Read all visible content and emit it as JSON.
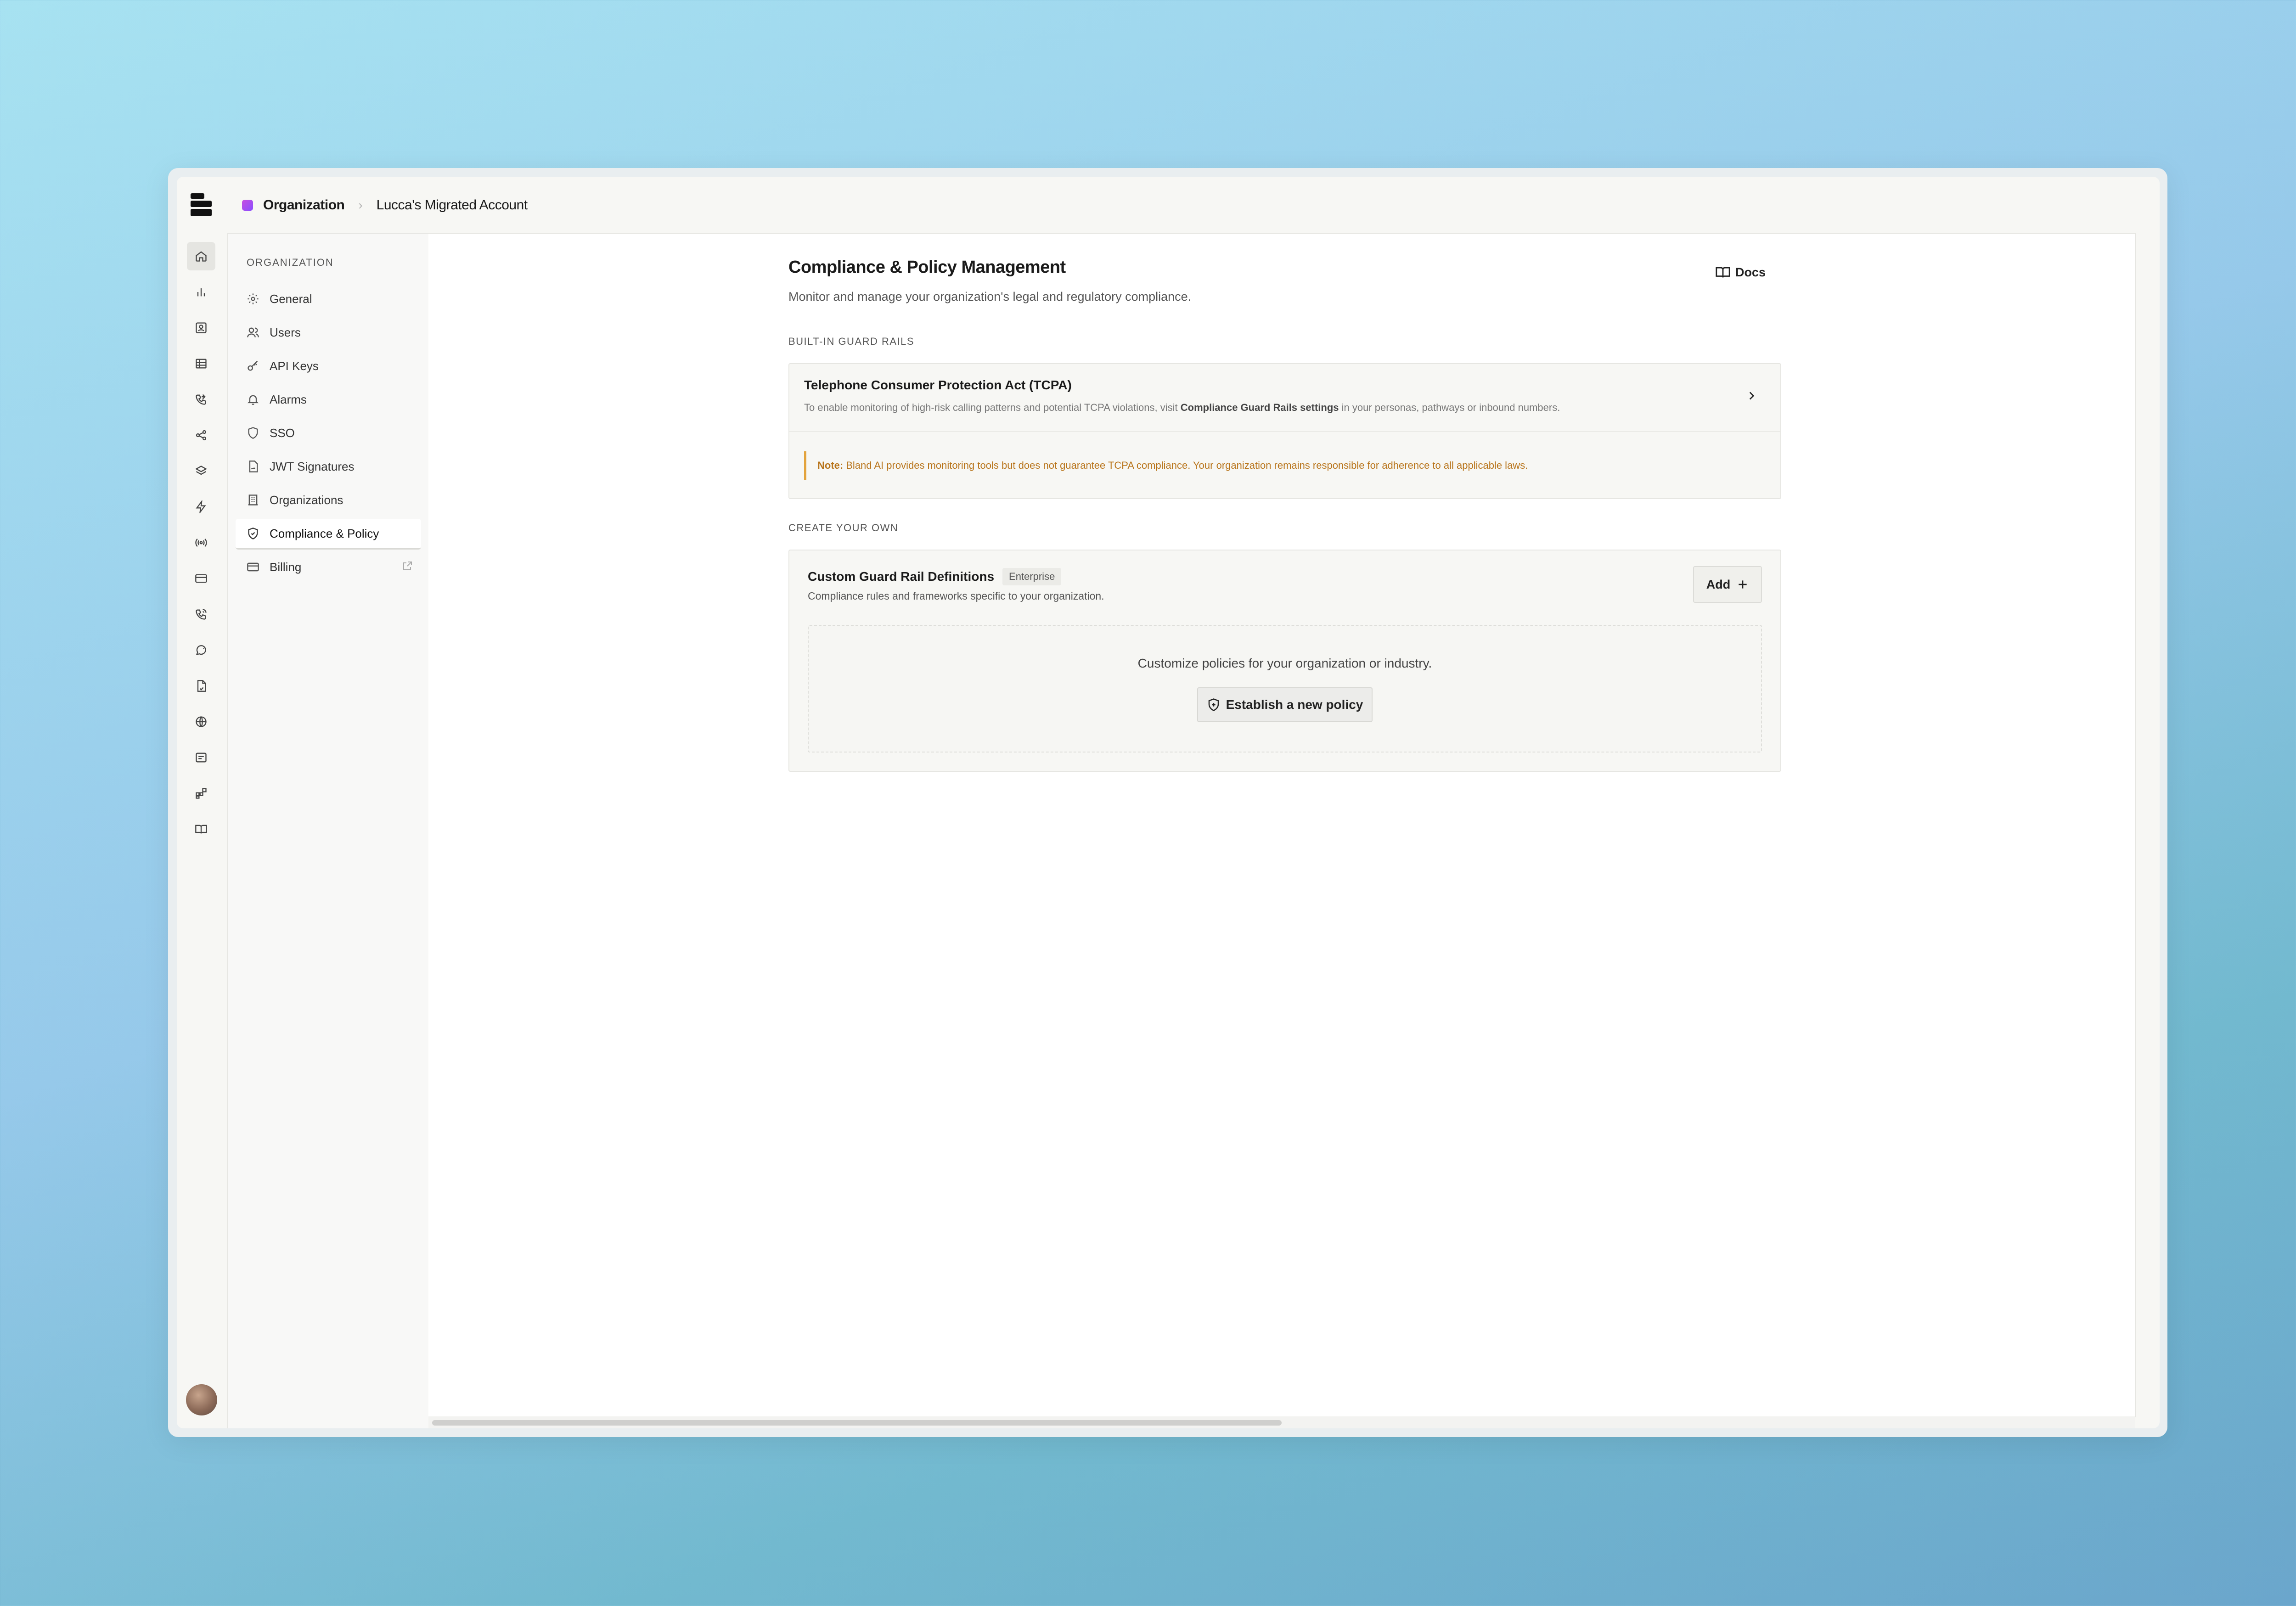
{
  "breadcrumb": {
    "organization": "Organization",
    "account": "Lucca's Migrated Account",
    "separator": "›"
  },
  "rail_icons": [
    "home-icon",
    "bar-chart-icon",
    "contact-card-icon",
    "table-icon",
    "phone-forward-icon",
    "share-nodes-icon",
    "layers-icon",
    "lightning-icon",
    "broadcast-icon",
    "credit-card-icon",
    "phone-call-icon",
    "chat-bubble-icon",
    "document-icon",
    "globe-icon",
    "message-square-icon",
    "widgets-icon",
    "book-icon"
  ],
  "sidebar": {
    "heading": "ORGANIZATION",
    "items": [
      {
        "label": "General",
        "icon": "gear-icon"
      },
      {
        "label": "Users",
        "icon": "users-icon"
      },
      {
        "label": "API Keys",
        "icon": "key-icon"
      },
      {
        "label": "Alarms",
        "icon": "bell-icon"
      },
      {
        "label": "SSO",
        "icon": "shield-icon"
      },
      {
        "label": "JWT Signatures",
        "icon": "file-signature-icon"
      },
      {
        "label": "Organizations",
        "icon": "building-icon"
      },
      {
        "label": "Compliance & Policy",
        "icon": "shield-check-icon",
        "active": true
      },
      {
        "label": "Billing",
        "icon": "credit-card-icon",
        "external": true
      }
    ]
  },
  "main": {
    "title": "Compliance & Policy Management",
    "subtitle": "Monitor and manage your organization's legal and regulatory compliance.",
    "docs_label": "Docs",
    "builtin_label": "BUILT-IN GUARD RAILS",
    "tcpa": {
      "title": "Telephone Consumer Protection Act (TCPA)",
      "desc_pre": "To enable monitoring of high-risk calling patterns and potential TCPA violations, visit ",
      "desc_bold": "Compliance Guard Rails settings",
      "desc_post": " in your personas, pathways or inbound numbers.",
      "note_label": "Note:",
      "note_text": "Bland AI provides monitoring tools but does not guarantee TCPA compliance. Your organization remains responsible for adherence to all applicable laws."
    },
    "create_label": "CREATE YOUR OWN",
    "custom": {
      "title": "Custom Guard Rail Definitions",
      "badge": "Enterprise",
      "desc": "Compliance rules and frameworks specific to your organization.",
      "add_label": "Add",
      "empty_text": "Customize policies for your organization or industry.",
      "establish_label": "Establish a new policy"
    }
  },
  "colors": {
    "accent_note": "#e3a33c",
    "note_text": "#b8741a",
    "org_dot": "#b04fe8"
  }
}
